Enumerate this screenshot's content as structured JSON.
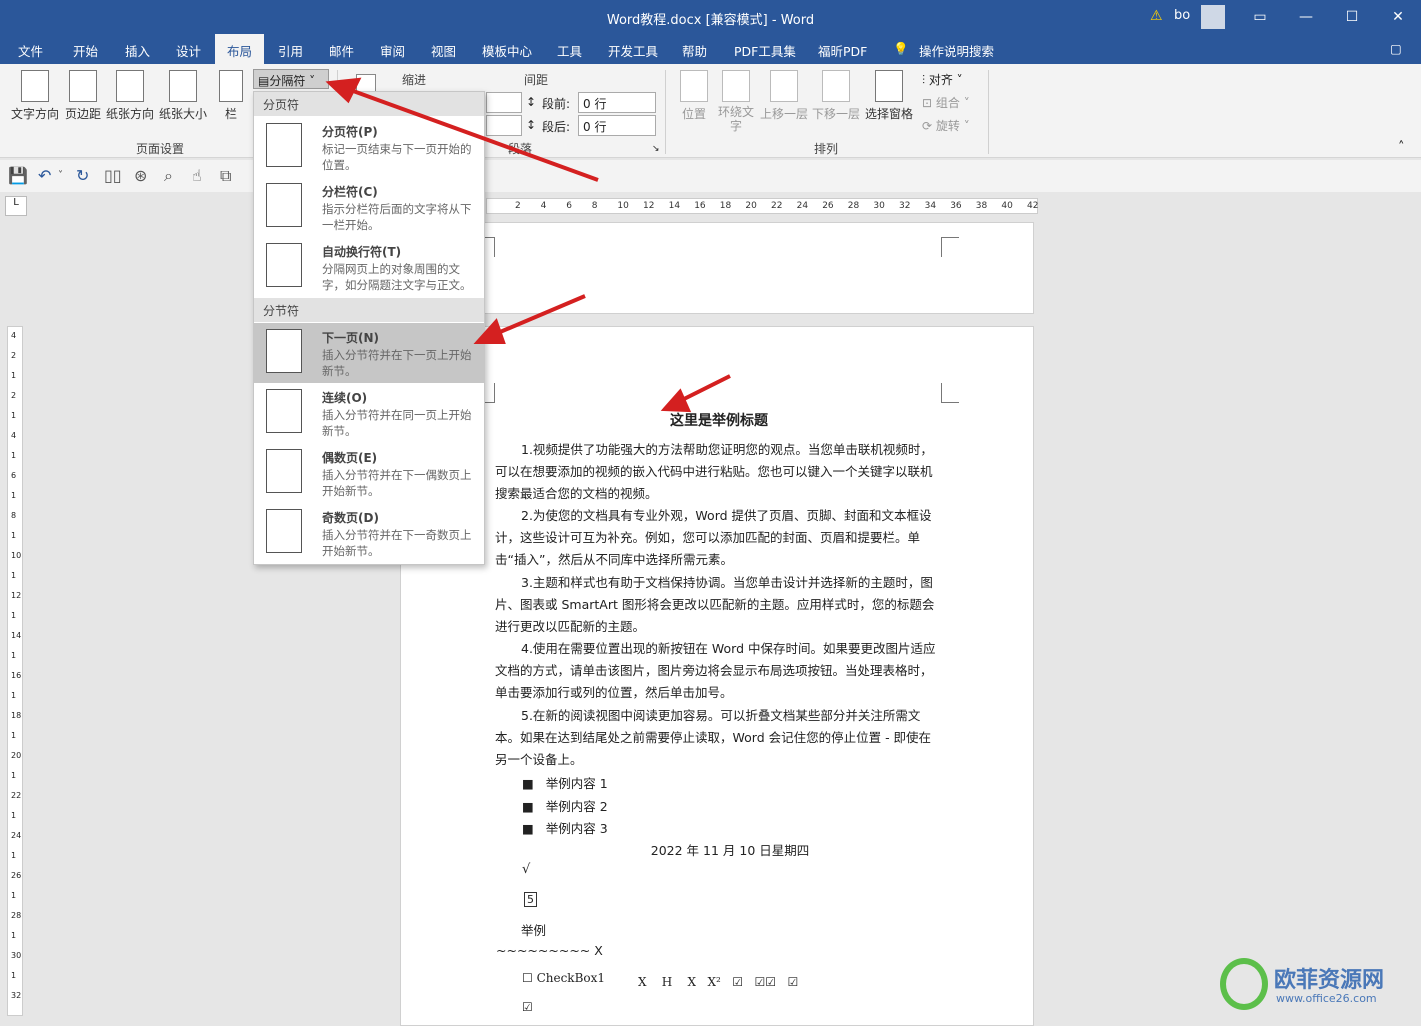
{
  "title": "Word教程.docx [兼容模式]  -  Word",
  "user": "bo",
  "warning_glyph": "⚠",
  "tabs": [
    "文件",
    "开始",
    "插入",
    "设计",
    "布局",
    "引用",
    "邮件",
    "审阅",
    "视图",
    "模板中心",
    "工具",
    "开发工具",
    "帮助",
    "PDF工具集",
    "福昕PDF",
    "操作说明搜索"
  ],
  "ribbon": {
    "text_direction": "文字方向",
    "margins": "页边距",
    "orientation": "纸张方向",
    "size": "纸张大小",
    "columns": "栏",
    "breaks_btn": "分隔符",
    "page_setup": "页面设置",
    "indent": "缩进",
    "spacing": "间距",
    "before": "段前:",
    "after": "段后:",
    "before_val": "0 行",
    "after_val": "0 行",
    "paragraph": "段落",
    "position": "位置",
    "wrap": "环绕文\n字",
    "bring_fwd": "上移一层",
    "send_back": "下移一层",
    "selection_pane": "选择窗格",
    "align": "对齐",
    "group": "组合",
    "rotate": "旋转",
    "arrange": "排列"
  },
  "menu": {
    "page_breaks": "分页符",
    "section_breaks": "分节符",
    "items": [
      {
        "name": "分页符(P)",
        "desc": "标记一页结束与下一页开始的位置。"
      },
      {
        "name": "分栏符(C)",
        "desc": "指示分栏符后面的文字将从下一栏开始。"
      },
      {
        "name": "自动换行符(T)",
        "desc": "分隔网页上的对象周围的文字，如分隔题注文字与正文。"
      },
      {
        "name": "下一页(N)",
        "desc": "插入分节符并在下一页上开始新节。"
      },
      {
        "name": "连续(O)",
        "desc": "插入分节符并在同一页上开始新节。"
      },
      {
        "name": "偶数页(E)",
        "desc": "插入分节符并在下一偶数页上开始新节。"
      },
      {
        "name": "奇数页(D)",
        "desc": "插入分节符并在下一奇数页上开始新节。"
      }
    ]
  },
  "ruler": [
    "2",
    "4",
    "6",
    "8",
    "10",
    "12",
    "14",
    "16",
    "18",
    "20",
    "22",
    "24",
    "26",
    "28",
    "30",
    "32",
    "34",
    "36",
    "38",
    "40",
    "42"
  ],
  "vruler": [
    "4",
    "2",
    "1",
    "2",
    "1",
    "4",
    "1",
    "6",
    "1",
    "8",
    "1",
    "10",
    "1",
    "12",
    "1",
    "14",
    "1",
    "16",
    "1",
    "18",
    "1",
    "20",
    "1",
    "22",
    "1",
    "24",
    "1",
    "26",
    "1",
    "28",
    "1",
    "30",
    "1",
    "32"
  ],
  "doc": {
    "heading": "这里是举例标题",
    "p1": "1.视频提供了功能强大的方法帮助您证明您的观点。当您单击联机视频时，可以在想要添加的视频的嵌入代码中进行粘贴。您也可以键入一个关键字以联机搜索最适合您的文档的视频。",
    "p2": "2.为使您的文档具有专业外观，Word 提供了页眉、页脚、封面和文本框设计，这些设计可互为补充。例如，您可以添加匹配的封面、页眉和提要栏。单击“插入”，然后从不同库中选择所需元素。",
    "p3": "3.主题和样式也有助于文档保持协调。当您单击设计并选择新的主题时，图片、图表或 SmartArt 图形将会更改以匹配新的主题。应用样式时，您的标题会进行更改以匹配新的主题。",
    "p4": "4.使用在需要位置出现的新按钮在 Word 中保存时间。如果要更改图片适应文档的方式，请单击该图片，图片旁边将会显示布局选项按钮。当处理表格时，单击要添加行或列的位置，然后单击加号。",
    "p5": "5.在新的阅读视图中阅读更加容易。可以折叠文档某些部分并关注所需文本。如果在达到结尾处之前需要停止读取，Word 会记住您的停止位置 - 即使在另一个设备上。",
    "bullets": [
      "举例内容 1",
      "举例内容 2",
      "举例内容 3"
    ],
    "date": "2022 年 11 月 10 日星期四",
    "check": "√",
    "boxed5": "5",
    "example": "举例",
    "tilde": "~~~~~~~~~  X",
    "checkbox": "☐ CheckBox1",
    "formula": "X    H    X   X²   ☑   ☑☑   ☑",
    "checked": "☑"
  },
  "watermark": {
    "brand": "欧菲资源网",
    "url": "www.office26.com"
  }
}
